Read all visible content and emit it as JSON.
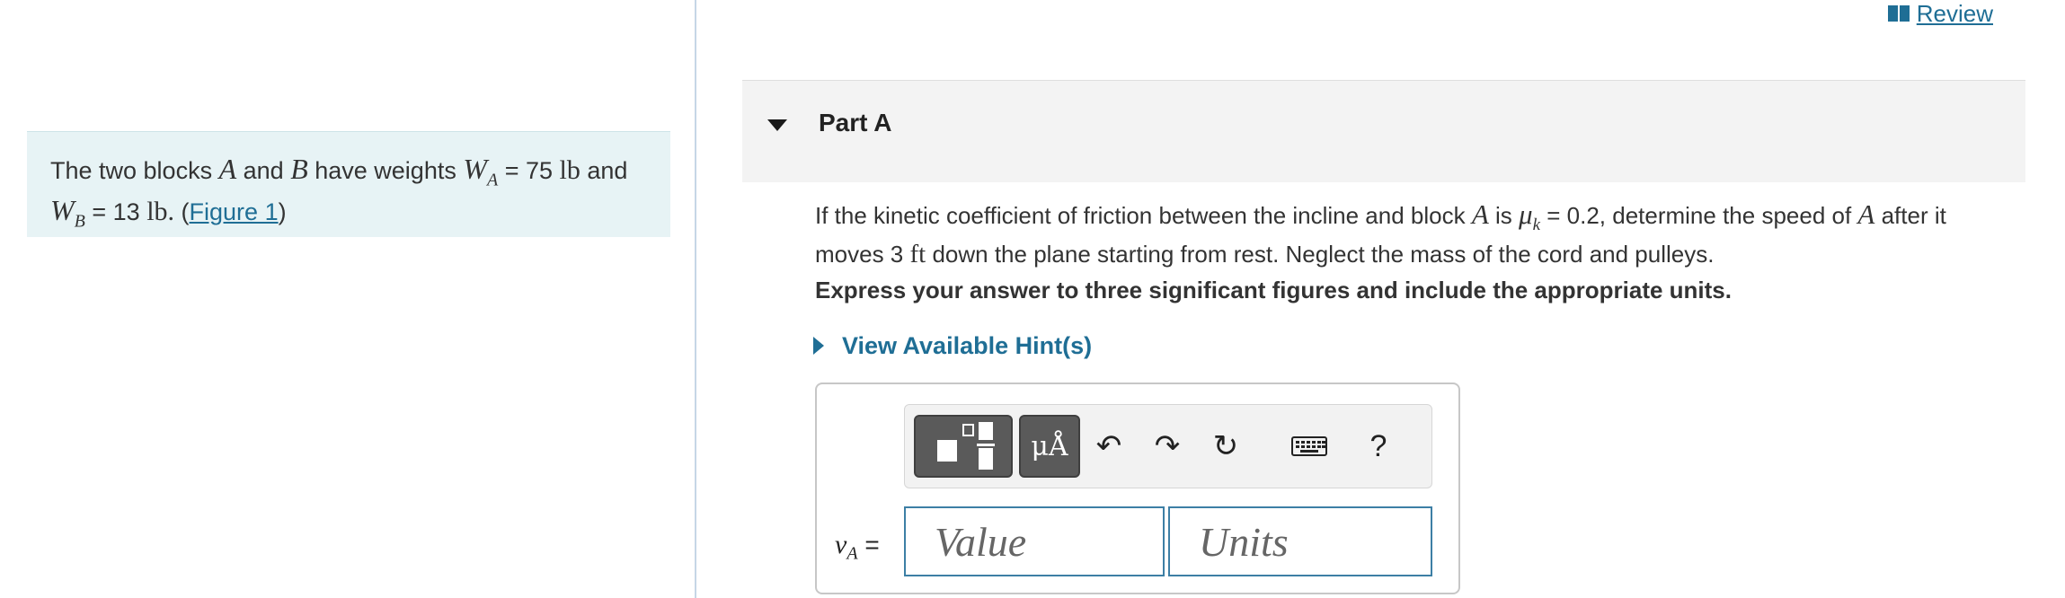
{
  "review": {
    "label": " Review",
    "icon": "book-icon"
  },
  "problem": {
    "text_before": "The two blocks ",
    "block_a": "A",
    "and": " and ",
    "block_b": "B",
    "have_weights": " have weights ",
    "wa_sym": "W",
    "wa_sub": "A",
    "wa_value": " = 75 ",
    "unit_lb": "lb",
    "and2": " and",
    "wb_sym": "W",
    "wb_sub": "B",
    "wb_value": " = 13 ",
    "unit_lb2": "lb.",
    "paren_open": " (",
    "figure_link": "Figure 1",
    "paren_close": ")"
  },
  "part": {
    "title": "Part A"
  },
  "question": {
    "t1": "If the kinetic coefficient of friction between the incline and block ",
    "a1": "A",
    "t2": " is ",
    "mu": "μ",
    "mu_sub": "k",
    "t3": " = 0.2, determine the speed of ",
    "a2": "A",
    "t4": " after it moves 3 ",
    "ft": "ft",
    "t5": " down the plane starting from rest. Neglect the mass of the cord and pulleys."
  },
  "instruction": "Express your answer to three significant figures and include the appropriate units.",
  "hint": {
    "label": "View Available Hint(s)"
  },
  "toolbar": {
    "units_label": "μÅ",
    "undo_glyph": "↶",
    "redo_glyph": "↷",
    "reset_glyph": "↻",
    "help_label": "?"
  },
  "answer": {
    "var_symbol": "v",
    "var_sub": "A",
    "equals": " =",
    "value_placeholder": "Value",
    "units_placeholder": "Units"
  }
}
